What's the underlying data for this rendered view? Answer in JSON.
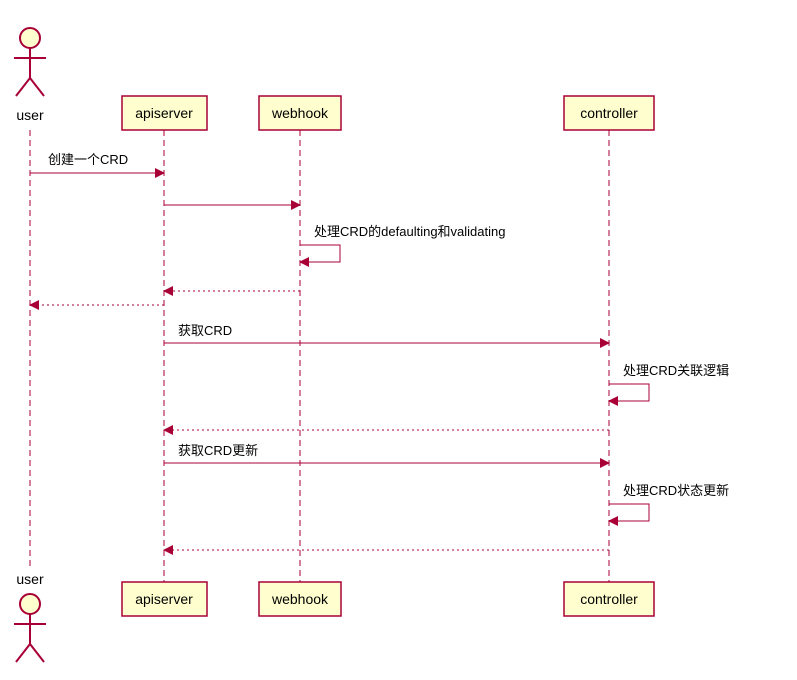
{
  "actors": {
    "user": "user"
  },
  "participants": {
    "apiserver": "apiserver",
    "webhook": "webhook",
    "controller": "controller"
  },
  "messages": {
    "m1": "创建一个CRD",
    "m2": "",
    "m3": "处理CRD的defaulting和validating",
    "m4": "",
    "m5": "",
    "m6": "获取CRD",
    "m7": "处理CRD关联逻辑",
    "m8": "",
    "m9": "获取CRD更新",
    "m10": "处理CRD状态更新",
    "m11": ""
  }
}
